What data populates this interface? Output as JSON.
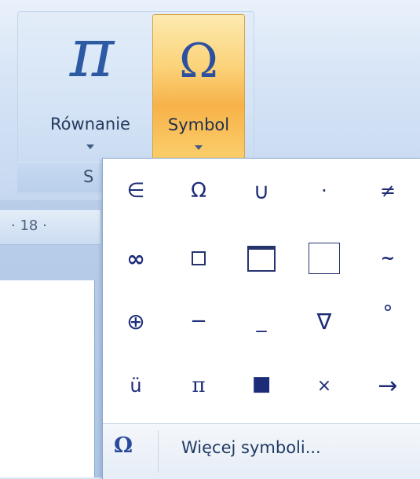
{
  "ribbon": {
    "equation_button": {
      "label": "Równanie",
      "glyph": "π"
    },
    "symbol_button": {
      "label": "Symbol",
      "glyph": "Ω"
    },
    "group_caption": "S"
  },
  "ruler": {
    "text": "· 18 ·"
  },
  "symbol_popup": {
    "symbols": [
      "∈",
      "Ω",
      "∪",
      "·",
      "≠",
      "∞",
      "□",
      "▭",
      "□",
      "~",
      "⊕",
      "−",
      "_",
      "∇",
      "°",
      "ü",
      "π",
      "■",
      "×",
      "→"
    ],
    "footer_icon": "Ω",
    "more_symbols_label": "Więcej symboli..."
  },
  "colors": {
    "accent_orange": "#f7b249",
    "symbol_blue": "#1d2c78"
  }
}
